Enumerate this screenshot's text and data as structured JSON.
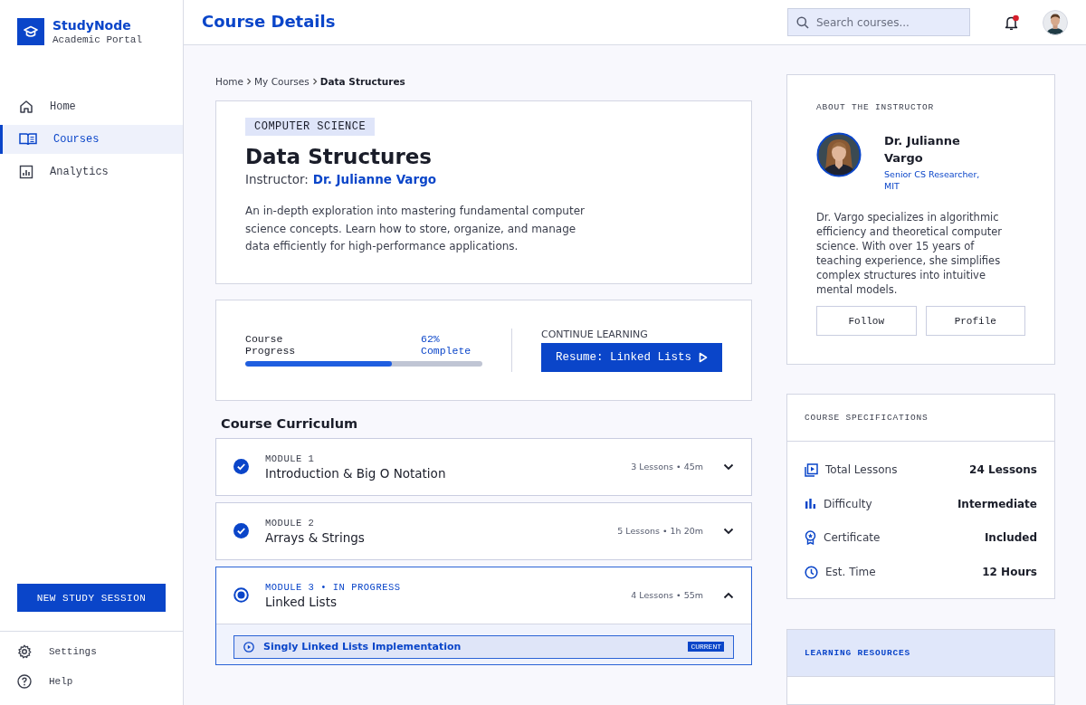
{
  "sidebar": {
    "brand": {
      "name": "StudyNode",
      "subtitle": "Academic Portal"
    },
    "nav": [
      {
        "label": "Home",
        "selected": false
      },
      {
        "label": "Courses",
        "selected": true
      },
      {
        "label": "Analytics",
        "selected": false
      }
    ],
    "cta": "NEW STUDY SESSION",
    "footer": [
      {
        "label": "Settings"
      },
      {
        "label": "Help"
      }
    ]
  },
  "header": {
    "title": "Course Details",
    "search": {
      "placeholder": "Search courses..."
    },
    "notifications_unread": true
  },
  "breadcrumb": [
    {
      "label": "Home",
      "current": false
    },
    {
      "label": "My Courses",
      "current": false
    },
    {
      "label": "Data Structures",
      "current": true
    }
  ],
  "course": {
    "category": "COMPUTER SCIENCE",
    "title": "Data Structures",
    "instructor_label": "Instructor:",
    "instructor": "Dr. Julianne Vargo",
    "description": "An in-depth exploration into mastering fundamental computer science concepts. Learn how to store, organize, and manage data efficiently for high-performance applications."
  },
  "progress": {
    "label": "Course Progress",
    "reading": "62% Complete",
    "level": 0.62,
    "continue_label": "CONTINUE LEARNING",
    "resume_button": "Resume: Linked Lists"
  },
  "curriculum": {
    "title": "Course Curriculum",
    "modules": [
      {
        "label": "MODULE 1",
        "title": "Introduction & Big O Notation",
        "meta": "3 Lessons • 45m",
        "completed": true,
        "expanded": false
      },
      {
        "label": "MODULE 2",
        "title": "Arrays & Strings",
        "meta": "5 Lessons • 1h 20m",
        "completed": true,
        "expanded": false
      },
      {
        "label": "MODULE 3 • IN PROGRESS",
        "title": "Linked Lists",
        "meta": "4 Lessons • 55m",
        "completed": false,
        "expanded": true,
        "lessons": [
          {
            "title": "Singly Linked Lists Implementation",
            "badge": "CURRENT"
          }
        ]
      }
    ]
  },
  "instructor_card": {
    "heading": "ABOUT THE INSTRUCTOR",
    "name": "Dr. Julianne Vargo",
    "role": "Senior CS Researcher, MIT",
    "bio": "Dr. Vargo specializes in algorithmic efficiency and theoretical computer science. With over 15 years of teaching experience, she simplifies complex structures into intuitive mental models.",
    "buttons": [
      "Follow",
      "Profile"
    ]
  },
  "specs": {
    "heading": "COURSE SPECIFICATIONS",
    "rows": [
      {
        "label": "Total Lessons",
        "value": "24 Lessons"
      },
      {
        "label": "Difficulty",
        "value": "Intermediate"
      },
      {
        "label": "Certificate",
        "value": "Included"
      },
      {
        "label": "Est. Time",
        "value": "12 Hours"
      }
    ]
  },
  "resources": {
    "heading": "LEARNING RESOURCES"
  }
}
